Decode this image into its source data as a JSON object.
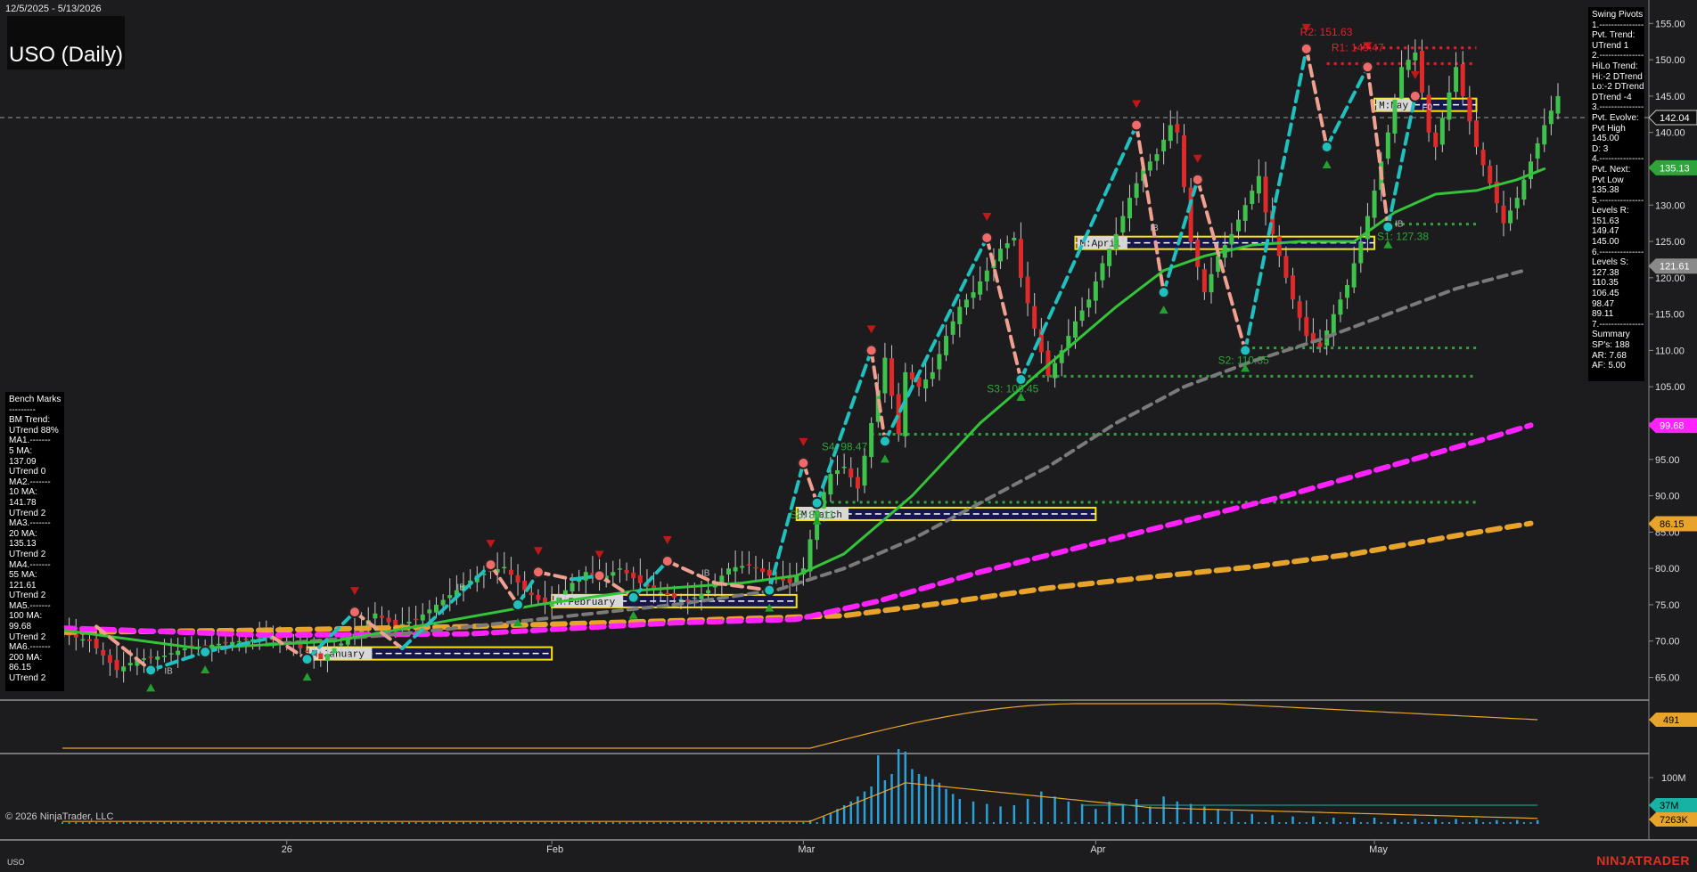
{
  "header": {
    "date_range": "12/5/2025 - 5/13/2026",
    "title": "USO (Daily)"
  },
  "bench_marks": [
    "Bench Marks",
    "---------",
    "BM Trend:",
    "UTrend 88%",
    "MA1.-------",
    "5 MA:",
    "137.09",
    "UTrend 0",
    "MA2.-------",
    "10 MA:",
    "141.78",
    "UTrend 2",
    "MA3.-------",
    "20 MA:",
    "135.13",
    "UTrend 2",
    "MA4.-------",
    "55 MA:",
    "121.61",
    "UTrend 2",
    "MA5.-------",
    "100 MA:",
    "99.68",
    "UTrend 2",
    "MA6.-------",
    "200 MA:",
    "86.15",
    "UTrend 2"
  ],
  "swing_pivots": [
    "Swing Pivots",
    "1.---------------",
    "Pvt. Trend:",
    "UTrend 1",
    "2.---------------",
    "HiLo Trend:",
    "Hi:-2 DTrend",
    "Lo:-2 DTrend",
    "DTrend -4",
    "3.---------------",
    "Pvt. Evolve:",
    "Pvt High",
    "145.00",
    "D: 3",
    "4.---------------",
    "Pvt. Next:",
    "Pvt Low",
    "135.38",
    "5.---------------",
    "Levels R:",
    "151.63",
    "149.47",
    "145.00",
    "6.---------------",
    "Levels S:",
    "127.38",
    "110.35",
    "106.45",
    "98.47",
    "89.11",
    "7.---------------",
    "Summary",
    "SP's: 188",
    "AR: 7.68",
    "AF: 5.00"
  ],
  "footer": {
    "copyright": "© 2026 NinjaTrader, LLC",
    "symbol": "USO",
    "brand": "NINJATRADER"
  },
  "chart_data": {
    "type": "candlestick",
    "title": "USO (Daily)",
    "ylim": [
      62,
      157
    ],
    "y_ticks": [
      "155.00",
      "150.00",
      "145.00",
      "140.00",
      "135.00",
      "130.00",
      "125.00",
      "120.00",
      "115.00",
      "110.00",
      "105.00",
      "100.00",
      "95.00",
      "90.00",
      "85.00",
      "80.00",
      "75.00",
      "70.00",
      "65.00"
    ],
    "x_tick_labels": [
      {
        "label": "26",
        "bar": 33
      },
      {
        "label": "Feb",
        "bar": 72
      },
      {
        "label": "Mar",
        "bar": 109
      },
      {
        "label": "Apr",
        "bar": 152
      },
      {
        "label": "May",
        "bar": 193
      }
    ],
    "bar_count": 207,
    "closes_anchors": [
      [
        0,
        71
      ],
      [
        4,
        70
      ],
      [
        8,
        66
      ],
      [
        11,
        67.5
      ],
      [
        15,
        68
      ],
      [
        18,
        69
      ],
      [
        22,
        69.5
      ],
      [
        26,
        70
      ],
      [
        30,
        70.5
      ],
      [
        33,
        70
      ],
      [
        36,
        68.5
      ],
      [
        38,
        67.5
      ],
      [
        40,
        69
      ],
      [
        43,
        71
      ],
      [
        46,
        73.8
      ],
      [
        49,
        72
      ],
      [
        52,
        73
      ],
      [
        55,
        75
      ],
      [
        58,
        77
      ],
      [
        61,
        79
      ],
      [
        65,
        80.2
      ],
      [
        68,
        77
      ],
      [
        71,
        75
      ],
      [
        73,
        76
      ],
      [
        75,
        78
      ],
      [
        77,
        79.5
      ],
      [
        79,
        78.5
      ],
      [
        82,
        80
      ],
      [
        85,
        78
      ],
      [
        87,
        77
      ],
      [
        90,
        76
      ],
      [
        92,
        75.5
      ],
      [
        95,
        77
      ],
      [
        98,
        80
      ],
      [
        101,
        80.5
      ],
      [
        104,
        79
      ],
      [
        107,
        78
      ],
      [
        109,
        80
      ],
      [
        111,
        88
      ],
      [
        113,
        93
      ],
      [
        115,
        94
      ],
      [
        117,
        91
      ],
      [
        119,
        100
      ],
      [
        121,
        109
      ],
      [
        123,
        98.5
      ],
      [
        124,
        107
      ],
      [
        126,
        105
      ],
      [
        128,
        107
      ],
      [
        130,
        112
      ],
      [
        132,
        116
      ],
      [
        134,
        118
      ],
      [
        136,
        121
      ],
      [
        138,
        124
      ],
      [
        140,
        125.5
      ],
      [
        141,
        120
      ],
      [
        143,
        113
      ],
      [
        145,
        106.5
      ],
      [
        147,
        110
      ],
      [
        149,
        114
      ],
      [
        151,
        117
      ],
      [
        153,
        122
      ],
      [
        155,
        126
      ],
      [
        157,
        131
      ],
      [
        159,
        135
      ],
      [
        161,
        137
      ],
      [
        163,
        141
      ],
      [
        164,
        140
      ],
      [
        166,
        125
      ],
      [
        168,
        118
      ],
      [
        170,
        123
      ],
      [
        172,
        126
      ],
      [
        174,
        130
      ],
      [
        176,
        134
      ],
      [
        177,
        129
      ],
      [
        179,
        123
      ],
      [
        181,
        117
      ],
      [
        183,
        112
      ],
      [
        185,
        110.5
      ],
      [
        187,
        115
      ],
      [
        189,
        119
      ],
      [
        191,
        125
      ],
      [
        193,
        132
      ],
      [
        195,
        140
      ],
      [
        197,
        149
      ],
      [
        199,
        151
      ],
      [
        201,
        140
      ],
      [
        202,
        138
      ],
      [
        203,
        142
      ],
      [
        205,
        149
      ],
      [
        206,
        145
      ],
      [
        208,
        138
      ],
      [
        210,
        133
      ],
      [
        212,
        127.5
      ],
      [
        214,
        131
      ],
      [
        216,
        136
      ],
      [
        218,
        141
      ],
      [
        220,
        145
      ]
    ],
    "volume_bars": [
      [
        110,
        3
      ],
      [
        112,
        6
      ],
      [
        113,
        9
      ],
      [
        114,
        12
      ],
      [
        115,
        15
      ],
      [
        116,
        18
      ],
      [
        117,
        22
      ],
      [
        118,
        26
      ],
      [
        119,
        30
      ],
      [
        120,
        55
      ],
      [
        121,
        35
      ],
      [
        122,
        40
      ],
      [
        123,
        60
      ],
      [
        124,
        58
      ],
      [
        125,
        44
      ],
      [
        126,
        40
      ],
      [
        127,
        38
      ],
      [
        128,
        36
      ],
      [
        129,
        33
      ],
      [
        130,
        28
      ],
      [
        131,
        24
      ],
      [
        132,
        20
      ],
      [
        134,
        18
      ],
      [
        136,
        16
      ],
      [
        138,
        14
      ],
      [
        140,
        15
      ],
      [
        142,
        20
      ],
      [
        144,
        26
      ],
      [
        146,
        22
      ],
      [
        148,
        18
      ],
      [
        150,
        16
      ],
      [
        152,
        12
      ],
      [
        154,
        18
      ],
      [
        156,
        16
      ],
      [
        158,
        20
      ],
      [
        160,
        14
      ],
      [
        162,
        22
      ],
      [
        164,
        18
      ],
      [
        166,
        16
      ],
      [
        168,
        14
      ],
      [
        170,
        12
      ],
      [
        172,
        10
      ],
      [
        175,
        8
      ],
      [
        178,
        7
      ],
      [
        181,
        6
      ],
      [
        184,
        6
      ],
      [
        187,
        5
      ],
      [
        190,
        5
      ],
      [
        193,
        5
      ],
      [
        196,
        4
      ],
      [
        199,
        4
      ],
      [
        202,
        4
      ],
      [
        205,
        4
      ],
      [
        208,
        4
      ],
      [
        211,
        3
      ],
      [
        214,
        3
      ],
      [
        217,
        3
      ]
    ],
    "series": [
      {
        "name": "5 MA",
        "value": 137.09,
        "color": "#9ad36a"
      },
      {
        "name": "10 MA",
        "value": 141.78,
        "color": "#6fbf5e"
      },
      {
        "name": "20 MA",
        "value": 135.13,
        "color": "#33c43a"
      },
      {
        "name": "55 MA",
        "value": 121.61,
        "color": "#7a7a7a"
      },
      {
        "name": "100 MA",
        "value": 99.68,
        "color": "#ff22ff"
      },
      {
        "name": "200 MA",
        "value": 86.15,
        "color": "#e8a42a"
      }
    ],
    "ma_paths": {
      "ma20": [
        [
          0,
          71.5
        ],
        [
          20,
          69
        ],
        [
          40,
          70
        ],
        [
          55,
          72.5
        ],
        [
          70,
          75
        ],
        [
          85,
          77
        ],
        [
          100,
          78
        ],
        [
          108,
          79
        ],
        [
          115,
          82
        ],
        [
          125,
          90
        ],
        [
          135,
          100
        ],
        [
          145,
          108
        ],
        [
          155,
          116
        ],
        [
          162,
          121
        ],
        [
          168,
          123
        ],
        [
          175,
          124.5
        ],
        [
          182,
          125
        ],
        [
          190,
          125
        ],
        [
          196,
          129
        ],
        [
          202,
          131.5
        ],
        [
          208,
          132
        ],
        [
          214,
          133.5
        ],
        [
          218,
          135
        ]
      ],
      "ma55": [
        [
          30,
          69.5
        ],
        [
          50,
          71
        ],
        [
          70,
          73
        ],
        [
          90,
          75
        ],
        [
          105,
          77
        ],
        [
          115,
          80
        ],
        [
          125,
          84
        ],
        [
          135,
          89
        ],
        [
          145,
          94
        ],
        [
          155,
          100
        ],
        [
          165,
          105
        ],
        [
          175,
          108.5
        ],
        [
          185,
          111.5
        ],
        [
          195,
          115
        ],
        [
          205,
          118.5
        ],
        [
          215,
          121
        ]
      ],
      "ma100": [
        [
          0,
          71.8
        ],
        [
          30,
          70.8
        ],
        [
          60,
          71
        ],
        [
          90,
          72.5
        ],
        [
          108,
          73
        ],
        [
          120,
          75.5
        ],
        [
          135,
          79.5
        ],
        [
          150,
          83
        ],
        [
          165,
          86.5
        ],
        [
          180,
          90
        ],
        [
          195,
          94
        ],
        [
          210,
          98
        ],
        [
          216,
          99.7
        ]
      ],
      "ma200": [
        [
          0,
          71.2
        ],
        [
          30,
          71.5
        ],
        [
          60,
          72
        ],
        [
          90,
          72.8
        ],
        [
          115,
          73.5
        ],
        [
          130,
          75.3
        ],
        [
          145,
          77.3
        ],
        [
          160,
          78.8
        ],
        [
          175,
          80.2
        ],
        [
          190,
          82
        ],
        [
          205,
          84.5
        ],
        [
          216,
          86.2
        ]
      ]
    },
    "zigzag": [
      [
        5,
        72
      ],
      [
        13,
        66
      ],
      [
        21,
        68.5
      ],
      [
        31,
        70.5
      ],
      [
        36,
        67.5
      ],
      [
        43,
        74
      ],
      [
        50,
        69
      ],
      [
        63,
        80.5
      ],
      [
        67,
        75
      ],
      [
        70,
        79.5
      ],
      [
        75,
        78.5
      ],
      [
        79,
        79
      ],
      [
        84,
        76
      ],
      [
        89,
        81
      ],
      [
        96,
        78
      ],
      [
        104,
        77
      ],
      [
        109,
        94.5
      ],
      [
        111,
        89
      ],
      [
        119,
        110
      ],
      [
        121,
        97.5
      ],
      [
        136,
        125.5
      ],
      [
        141,
        106
      ],
      [
        158,
        141
      ],
      [
        162,
        118
      ],
      [
        167,
        133.5
      ],
      [
        174,
        110
      ],
      [
        183,
        151.5
      ],
      [
        186,
        138
      ],
      [
        192,
        149
      ],
      [
        195,
        127
      ],
      [
        199,
        145
      ]
    ],
    "pivot_highs": [
      [
        43,
        74
      ],
      [
        63,
        80.5
      ],
      [
        70,
        79.5
      ],
      [
        79,
        79
      ],
      [
        89,
        81
      ],
      [
        109,
        94.5
      ],
      [
        119,
        110
      ],
      [
        136,
        125.5
      ],
      [
        158,
        141
      ],
      [
        167,
        133.5
      ],
      [
        183,
        151.5
      ],
      [
        192,
        149
      ],
      [
        199,
        145
      ]
    ],
    "pivot_lows": [
      [
        13,
        66
      ],
      [
        21,
        68.5
      ],
      [
        36,
        67.5
      ],
      [
        67,
        75
      ],
      [
        84,
        76
      ],
      [
        104,
        77
      ],
      [
        111,
        89
      ],
      [
        121,
        97.5
      ],
      [
        141,
        106
      ],
      [
        162,
        118
      ],
      [
        174,
        110
      ],
      [
        186,
        138
      ],
      [
        195,
        127
      ]
    ],
    "levels": [
      {
        "label": "R2: 151.63",
        "value": 151.63,
        "color": "#e8202a",
        "from_bar": 190,
        "to_bar": 208
      },
      {
        "label": "R1: 149.47",
        "value": 149.47,
        "color": "#e8202a",
        "from_bar": 186,
        "to_bar": 208
      },
      {
        "label": "S1: 127.38",
        "value": 127.38,
        "color": "#2fa43a",
        "from_bar": 196,
        "to_bar": 208
      },
      {
        "label": "S2: 110.35",
        "value": 110.35,
        "color": "#2fa43a",
        "from_bar": 174,
        "to_bar": 208
      },
      {
        "label": "S3: 106.45",
        "value": 106.45,
        "color": "#2fa43a",
        "from_bar": 141,
        "to_bar": 208
      },
      {
        "label": "S4: 98.47",
        "value": 98.47,
        "color": "#2fa43a",
        "from_bar": 119,
        "to_bar": 208
      },
      {
        "label": "S5: 89.11",
        "value": 89.11,
        "color": "#2fa43a",
        "from_bar": 111,
        "to_bar": 208
      }
    ],
    "month_boxes": [
      {
        "label": "M:January",
        "value": 68.3,
        "from_bar": 36,
        "to_bar": 72
      },
      {
        "label": "M:February",
        "value": 75.5,
        "from_bar": 72,
        "to_bar": 108
      },
      {
        "label": "M:March",
        "value": 87.5,
        "from_bar": 108,
        "to_bar": 152
      },
      {
        "label": "M:April",
        "value": 124.8,
        "from_bar": 149,
        "to_bar": 193
      },
      {
        "label": "M:May",
        "value": 143.8,
        "from_bar": 193,
        "to_bar": 208
      }
    ],
    "y_axis_markers": [
      {
        "label": "142.04",
        "value": 142.04,
        "bg": "#111111",
        "fg": "#ffffff",
        "border": "#cccccc"
      },
      {
        "label": "135.13",
        "value": 135.13,
        "bg": "#2fa43a",
        "fg": "#ffffff",
        "border": "#2fa43a"
      },
      {
        "label": "121.61",
        "value": 121.61,
        "bg": "#8a8a8a",
        "fg": "#ffffff",
        "border": "#8a8a8a"
      },
      {
        "label": "99.68",
        "value": 99.68,
        "bg": "#ff22ff",
        "fg": "#ffffff",
        "border": "#ff22ff"
      },
      {
        "label": "86.15",
        "value": 86.15,
        "bg": "#e8a42a",
        "fg": "#000000",
        "border": "#e8a42a"
      }
    ],
    "indicator_panel": {
      "label": "491",
      "color": "#e8a42a"
    },
    "volume_panel": {
      "y_tick": "100M",
      "markers": [
        {
          "label": "37M",
          "bg": "#17b2a4"
        },
        {
          "label": "7263K",
          "bg": "#e8a42a"
        }
      ]
    },
    "annotations": {
      "f0": "F0",
      "ib": "IB"
    }
  }
}
